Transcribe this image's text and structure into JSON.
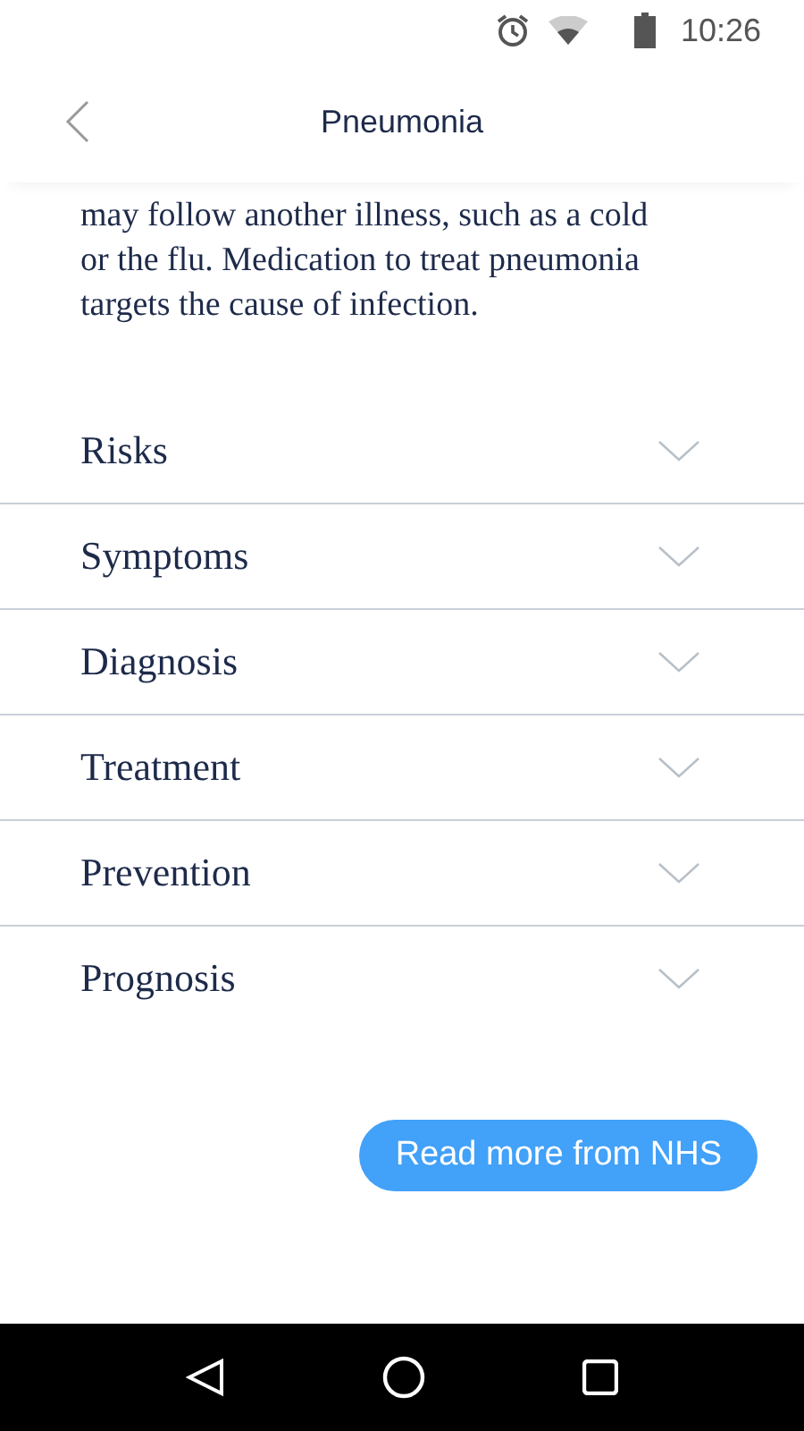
{
  "status_bar": {
    "time": "10:26"
  },
  "header": {
    "title": "Pneumonia"
  },
  "intro": "may follow another illness, such as a cold or the flu. Medication to treat pneumonia targets the cause of infection.",
  "sections": [
    {
      "label": "Risks",
      "expanded": false
    },
    {
      "label": "Symptoms",
      "expanded": false
    },
    {
      "label": "Diagnosis",
      "expanded": false
    },
    {
      "label": "Treatment",
      "expanded": false
    },
    {
      "label": "Prevention",
      "expanded": false
    },
    {
      "label": "Prognosis",
      "expanded": false
    }
  ],
  "read_more_button": "Read more from NHS"
}
